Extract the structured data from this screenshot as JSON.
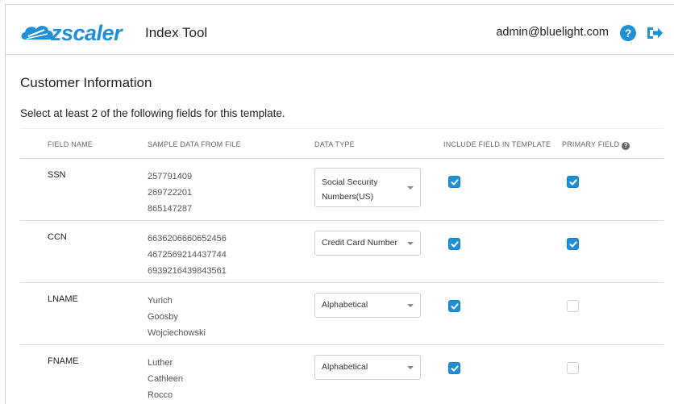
{
  "header": {
    "logo_text": "zscaler",
    "app_title": "Index Tool",
    "user_email": "admin@bluelight.com",
    "help_icon_glyph": "?"
  },
  "section": {
    "title": "Customer Information",
    "instruction": "Select at least 2 of the following fields for this template."
  },
  "table": {
    "columns": {
      "field_name": "FIELD NAME",
      "sample_data": "SAMPLE DATA FROM FILE",
      "data_type": "DATA TYPE",
      "include": "INCLUDE FIELD IN TEMPLATE",
      "primary": "PRIMARY FIELD"
    },
    "rows": [
      {
        "field": "SSN",
        "samples": [
          "257791409",
          "269722201",
          "865147287"
        ],
        "data_type": "Social Security Numbers(US)",
        "include": true,
        "primary": true
      },
      {
        "field": "CCN",
        "samples": [
          "6636206660652456",
          "4672569214437744",
          "6939216439843561"
        ],
        "data_type": "Credit Card Number",
        "include": true,
        "primary": true
      },
      {
        "field": "LNAME",
        "samples": [
          "Yurich",
          "Goosby",
          "Wojciechowski"
        ],
        "data_type": "Alphabetical",
        "include": true,
        "primary": false
      },
      {
        "field": "FNAME",
        "samples": [
          "Luther",
          "Cathleen",
          "Rocco"
        ],
        "data_type": "Alphabetical",
        "include": true,
        "primary": false
      }
    ]
  },
  "colors": {
    "accent": "#1f8fd6",
    "border": "#dcdcdc"
  }
}
